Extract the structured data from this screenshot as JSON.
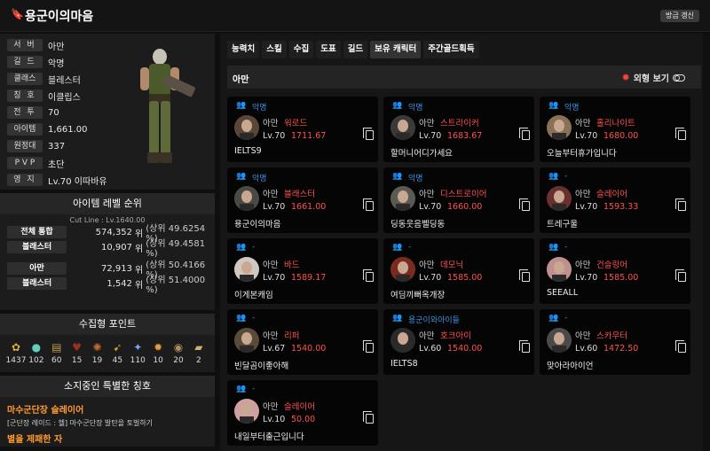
{
  "header": {
    "title": "용군이의마음",
    "refresh": "방금 갱신"
  },
  "profile": {
    "rows": [
      {
        "label": "서 버",
        "value": "아만"
      },
      {
        "label": "길 드",
        "value": "악명"
      },
      {
        "label": "클래스",
        "value": "블레스터"
      },
      {
        "label": "칭 호",
        "value": "이클립스"
      },
      {
        "label": "전 투",
        "value": "70"
      },
      {
        "label": "아이템",
        "value": "1,661.00"
      },
      {
        "label": "원정대",
        "value": "337"
      },
      {
        "label": "P V P",
        "value": "초단"
      },
      {
        "label": "영 지",
        "value": "Lv.70 이따바유"
      }
    ]
  },
  "ranking": {
    "title": "아이템 레벨 순위",
    "cutline": "Cut Line : Lv.1640.00",
    "rows": [
      {
        "label": "전체 통합",
        "rank": "574,352",
        "unit": "위",
        "pct": "(상위 49.6254 %)"
      },
      {
        "label": "블래스터",
        "rank": "10,907",
        "unit": "위",
        "pct": "(상위 49.4581 %)"
      },
      {
        "label": "아만",
        "rank": "72,913",
        "unit": "위",
        "pct": "(상위 50.4166 %)"
      },
      {
        "label": "블래스터",
        "rank": "1,542",
        "unit": "위",
        "pct": "(상위 51.4000 %)"
      }
    ]
  },
  "collect": {
    "title": "수집형 포인트",
    "items": [
      {
        "icon": "seed-icon",
        "value": "1437"
      },
      {
        "icon": "island-icon",
        "value": "102"
      },
      {
        "icon": "map-icon",
        "value": "60"
      },
      {
        "icon": "heart-icon",
        "value": "15"
      },
      {
        "icon": "art-icon",
        "value": "19"
      },
      {
        "icon": "navigation-icon",
        "value": "45"
      },
      {
        "icon": "leaf-icon",
        "value": "110"
      },
      {
        "icon": "medal-icon",
        "value": "10"
      },
      {
        "icon": "orpheus-icon",
        "value": "20"
      },
      {
        "icon": "scroll-icon",
        "value": "2"
      }
    ]
  },
  "titles": {
    "title": "소지중인 특별한 칭호",
    "items": [
      {
        "name": "마수군단장 슬레이어",
        "desc": "[군단장 레이드 : 헬] 마수군단장 발탄을 토벌하기"
      },
      {
        "name": "별을 제패한 자",
        "desc": ""
      }
    ]
  },
  "tabs": [
    "능력치",
    "스킬",
    "수집",
    "도표",
    "길드",
    "보유 캐릭터",
    "주간골드획득"
  ],
  "active_tab": "보유 캐릭터",
  "server_bar": {
    "server": "아만",
    "appearance": "외형 보기"
  },
  "characters": [
    {
      "guild": "악명",
      "server": "아만",
      "job": "워로드",
      "lv": "Lv.70",
      "il": "1711.67",
      "name": "IELTS9"
    },
    {
      "guild": "악명",
      "server": "아만",
      "job": "스트라이커",
      "lv": "Lv.70",
      "il": "1683.67",
      "name": "할머니어디가세요"
    },
    {
      "guild": "악명",
      "server": "아만",
      "job": "홀리나이트",
      "lv": "Lv.70",
      "il": "1680.00",
      "name": "오늘부터휴가입니다"
    },
    {
      "guild": "악명",
      "server": "아만",
      "job": "블래스터",
      "lv": "Lv.70",
      "il": "1661.00",
      "name": "용군이의마음"
    },
    {
      "guild": "악명",
      "server": "아만",
      "job": "디스트로이어",
      "lv": "Lv.70",
      "il": "1660.00",
      "name": "딩동웃음벨딩동"
    },
    {
      "guild": "-",
      "server": "아만",
      "job": "슬레이어",
      "lv": "Lv.70",
      "il": "1593.33",
      "name": "트레구울"
    },
    {
      "guild": "-",
      "server": "아만",
      "job": "바드",
      "lv": "Lv.70",
      "il": "1589.17",
      "name": "이게본캐임"
    },
    {
      "guild": "-",
      "server": "아만",
      "job": "데모닉",
      "lv": "Lv.70",
      "il": "1585.00",
      "name": "여딤끼뻐옥개장"
    },
    {
      "guild": "-",
      "server": "아만",
      "job": "건슬링어",
      "lv": "Lv.70",
      "il": "1585.00",
      "name": "SEEALL"
    },
    {
      "guild": "-",
      "server": "아만",
      "job": "리퍼",
      "lv": "Lv.67",
      "il": "1540.00",
      "name": "빈달곰이좋아해"
    },
    {
      "guild": "용군이와아이들",
      "server": "아만",
      "job": "호크아이",
      "lv": "Lv.60",
      "il": "1540.00",
      "name": "IELTS8"
    },
    {
      "guild": "-",
      "server": "아만",
      "job": "스카우터",
      "lv": "Lv.60",
      "il": "1472.50",
      "name": "맞아라아이언"
    },
    {
      "guild": "-",
      "server": "아만",
      "job": "슬레이어",
      "lv": "Lv.10",
      "il": "50.00",
      "name": "내일부터출근입니다"
    }
  ],
  "colors": {
    "accent_red": "#ff5050",
    "guild_blue": "#3d8fe0",
    "title_orange": "#ff9a2e"
  }
}
